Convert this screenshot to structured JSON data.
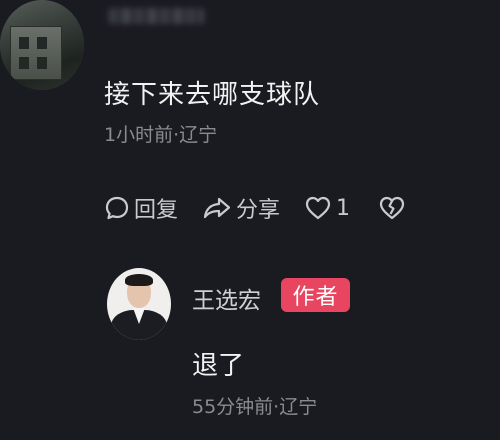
{
  "comment": {
    "text": "接下来去哪支球队",
    "meta": "1小时前·辽宁",
    "actions": {
      "reply_label": "回复",
      "share_label": "分享",
      "like_count": "1"
    }
  },
  "reply": {
    "author": "王选宏",
    "author_badge": "作者",
    "text": "退了",
    "meta": "55分钟前·辽宁"
  },
  "colors": {
    "background": "#1a1b21",
    "badge": "#e84660",
    "meta_text": "#8a8b90"
  },
  "icons": {
    "reply": "comment-bubble-icon",
    "share": "share-arrow-icon",
    "like": "heart-icon",
    "dislike": "broken-heart-icon"
  }
}
